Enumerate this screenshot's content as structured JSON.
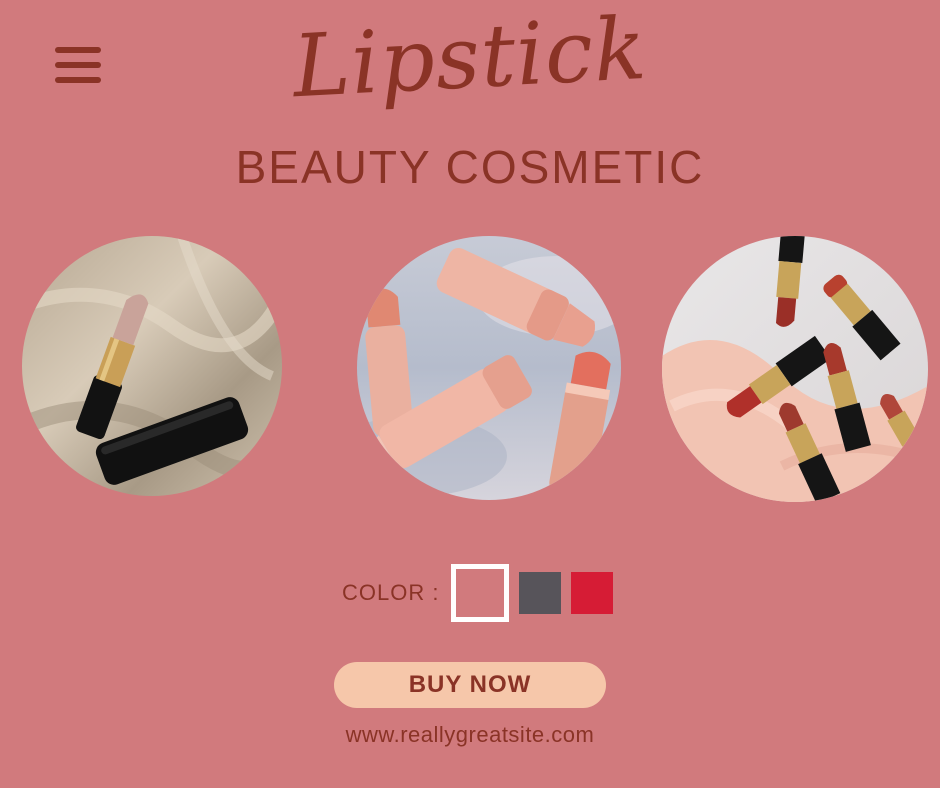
{
  "header": {
    "menu_icon": "hamburger-menu-icon",
    "title": "Lipstick",
    "subtitle": "BEAUTY COSMETIC"
  },
  "colors": {
    "background": "#d17a7d",
    "text": "#8a3326",
    "button": "#f6c7aa"
  },
  "product": {
    "color_label": "COLOR :",
    "swatches": [
      {
        "color": "#d17a7d",
        "selected": true
      },
      {
        "color": "#57545a",
        "selected": false
      },
      {
        "color": "#d61c35",
        "selected": false
      }
    ],
    "buy_label": "BUY NOW"
  },
  "footer": {
    "website": "www.reallygreatsite.com"
  }
}
